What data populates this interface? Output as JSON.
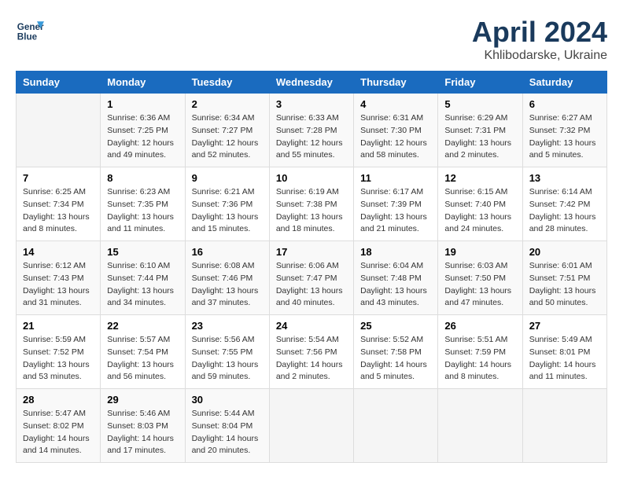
{
  "header": {
    "logo_line1": "General",
    "logo_line2": "Blue",
    "title": "April 2024",
    "subtitle": "Khlibodarske, Ukraine"
  },
  "weekdays": [
    "Sunday",
    "Monday",
    "Tuesday",
    "Wednesday",
    "Thursday",
    "Friday",
    "Saturday"
  ],
  "weeks": [
    [
      {
        "day": "",
        "info": ""
      },
      {
        "day": "1",
        "info": "Sunrise: 6:36 AM\nSunset: 7:25 PM\nDaylight: 12 hours\nand 49 minutes."
      },
      {
        "day": "2",
        "info": "Sunrise: 6:34 AM\nSunset: 7:27 PM\nDaylight: 12 hours\nand 52 minutes."
      },
      {
        "day": "3",
        "info": "Sunrise: 6:33 AM\nSunset: 7:28 PM\nDaylight: 12 hours\nand 55 minutes."
      },
      {
        "day": "4",
        "info": "Sunrise: 6:31 AM\nSunset: 7:30 PM\nDaylight: 12 hours\nand 58 minutes."
      },
      {
        "day": "5",
        "info": "Sunrise: 6:29 AM\nSunset: 7:31 PM\nDaylight: 13 hours\nand 2 minutes."
      },
      {
        "day": "6",
        "info": "Sunrise: 6:27 AM\nSunset: 7:32 PM\nDaylight: 13 hours\nand 5 minutes."
      }
    ],
    [
      {
        "day": "7",
        "info": "Sunrise: 6:25 AM\nSunset: 7:34 PM\nDaylight: 13 hours\nand 8 minutes."
      },
      {
        "day": "8",
        "info": "Sunrise: 6:23 AM\nSunset: 7:35 PM\nDaylight: 13 hours\nand 11 minutes."
      },
      {
        "day": "9",
        "info": "Sunrise: 6:21 AM\nSunset: 7:36 PM\nDaylight: 13 hours\nand 15 minutes."
      },
      {
        "day": "10",
        "info": "Sunrise: 6:19 AM\nSunset: 7:38 PM\nDaylight: 13 hours\nand 18 minutes."
      },
      {
        "day": "11",
        "info": "Sunrise: 6:17 AM\nSunset: 7:39 PM\nDaylight: 13 hours\nand 21 minutes."
      },
      {
        "day": "12",
        "info": "Sunrise: 6:15 AM\nSunset: 7:40 PM\nDaylight: 13 hours\nand 24 minutes."
      },
      {
        "day": "13",
        "info": "Sunrise: 6:14 AM\nSunset: 7:42 PM\nDaylight: 13 hours\nand 28 minutes."
      }
    ],
    [
      {
        "day": "14",
        "info": "Sunrise: 6:12 AM\nSunset: 7:43 PM\nDaylight: 13 hours\nand 31 minutes."
      },
      {
        "day": "15",
        "info": "Sunrise: 6:10 AM\nSunset: 7:44 PM\nDaylight: 13 hours\nand 34 minutes."
      },
      {
        "day": "16",
        "info": "Sunrise: 6:08 AM\nSunset: 7:46 PM\nDaylight: 13 hours\nand 37 minutes."
      },
      {
        "day": "17",
        "info": "Sunrise: 6:06 AM\nSunset: 7:47 PM\nDaylight: 13 hours\nand 40 minutes."
      },
      {
        "day": "18",
        "info": "Sunrise: 6:04 AM\nSunset: 7:48 PM\nDaylight: 13 hours\nand 43 minutes."
      },
      {
        "day": "19",
        "info": "Sunrise: 6:03 AM\nSunset: 7:50 PM\nDaylight: 13 hours\nand 47 minutes."
      },
      {
        "day": "20",
        "info": "Sunrise: 6:01 AM\nSunset: 7:51 PM\nDaylight: 13 hours\nand 50 minutes."
      }
    ],
    [
      {
        "day": "21",
        "info": "Sunrise: 5:59 AM\nSunset: 7:52 PM\nDaylight: 13 hours\nand 53 minutes."
      },
      {
        "day": "22",
        "info": "Sunrise: 5:57 AM\nSunset: 7:54 PM\nDaylight: 13 hours\nand 56 minutes."
      },
      {
        "day": "23",
        "info": "Sunrise: 5:56 AM\nSunset: 7:55 PM\nDaylight: 13 hours\nand 59 minutes."
      },
      {
        "day": "24",
        "info": "Sunrise: 5:54 AM\nSunset: 7:56 PM\nDaylight: 14 hours\nand 2 minutes."
      },
      {
        "day": "25",
        "info": "Sunrise: 5:52 AM\nSunset: 7:58 PM\nDaylight: 14 hours\nand 5 minutes."
      },
      {
        "day": "26",
        "info": "Sunrise: 5:51 AM\nSunset: 7:59 PM\nDaylight: 14 hours\nand 8 minutes."
      },
      {
        "day": "27",
        "info": "Sunrise: 5:49 AM\nSunset: 8:01 PM\nDaylight: 14 hours\nand 11 minutes."
      }
    ],
    [
      {
        "day": "28",
        "info": "Sunrise: 5:47 AM\nSunset: 8:02 PM\nDaylight: 14 hours\nand 14 minutes."
      },
      {
        "day": "29",
        "info": "Sunrise: 5:46 AM\nSunset: 8:03 PM\nDaylight: 14 hours\nand 17 minutes."
      },
      {
        "day": "30",
        "info": "Sunrise: 5:44 AM\nSunset: 8:04 PM\nDaylight: 14 hours\nand 20 minutes."
      },
      {
        "day": "",
        "info": ""
      },
      {
        "day": "",
        "info": ""
      },
      {
        "day": "",
        "info": ""
      },
      {
        "day": "",
        "info": ""
      }
    ]
  ]
}
